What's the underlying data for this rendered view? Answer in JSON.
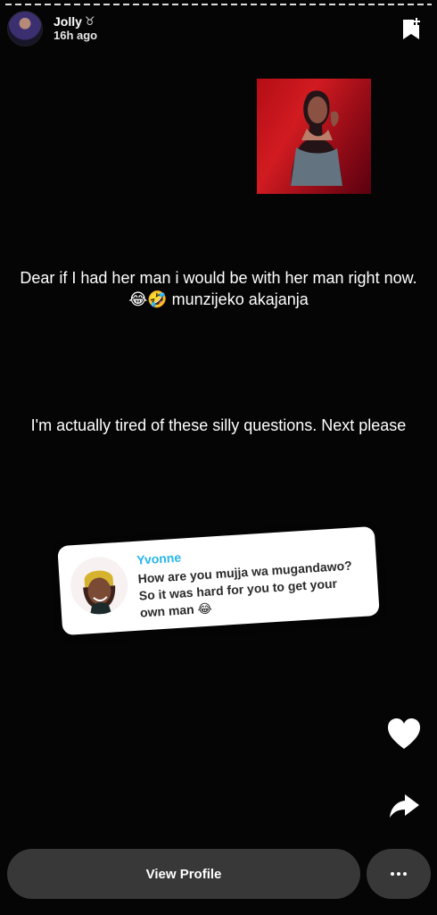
{
  "story": {
    "username": "Jolly",
    "zodiac_symbol": "♉",
    "time_ago": "16h ago"
  },
  "captions": {
    "first": "Dear if I had her man i would be with her man right now. 😂🤣 munzijeko akajanja",
    "second": "I'm actually tired of these silly questions. Next please"
  },
  "question_card": {
    "name": "Yvonne",
    "text": "How are you mujja wa mugandawo? So it was hard for you to get your own man 😂"
  },
  "actions": {
    "view_profile": "View Profile"
  },
  "icons": {
    "save": "bookmark-plus-icon",
    "like": "heart-icon",
    "share": "share-arrow-icon",
    "more": "more-dots-icon"
  },
  "colors": {
    "background": "#050505",
    "card_name": "#29b6e8",
    "button_background": "#383838"
  }
}
